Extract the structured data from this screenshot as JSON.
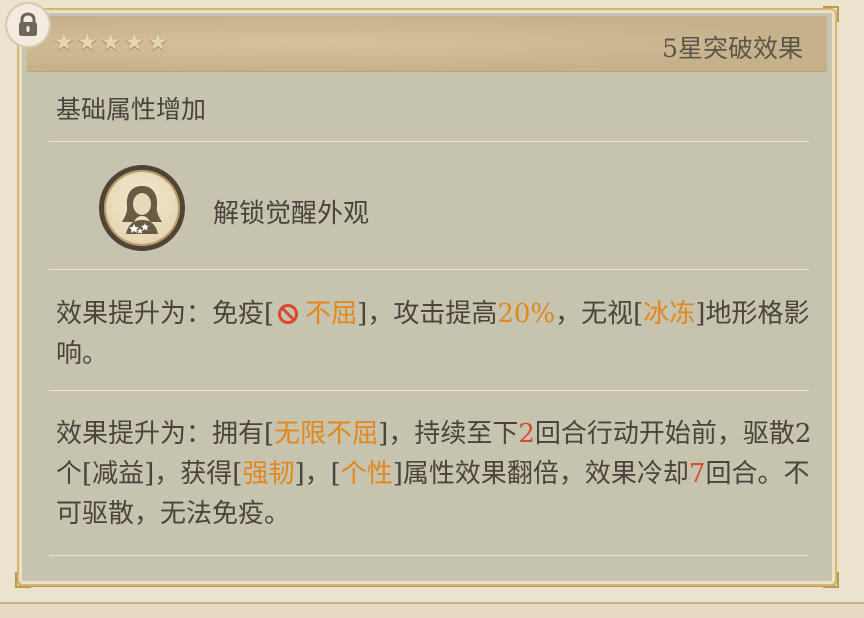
{
  "header": {
    "title": "5星突破效果",
    "stars": 5
  },
  "sections": {
    "base_attr": "基础属性增加",
    "awaken": {
      "label": "解锁觉醒外观",
      "icon": "character-portrait-icon"
    }
  },
  "effect1": {
    "p1": "效果提升为：免疫[",
    "status_icon": "prohibited-icon",
    "status": "不屈",
    "p2": "]，攻击提高",
    "attack": "20%",
    "p3": "，无视[",
    "terrain": "冰冻",
    "p4": "]地形格影响。"
  },
  "effect2": {
    "p1": "效果提升为：拥有[",
    "buff1": "无限不屈",
    "p2": "]，持续至下",
    "turns1": "2",
    "p3": "回合行动开始前，驱散2个[减益]，获得[",
    "buff2": "强韧",
    "p4": "]，[",
    "buff3": "个性",
    "p5": "]属性效果翻倍，效果冷却",
    "cooldown": "7",
    "p6": "回合。不可驱散，无法免疫。"
  },
  "colors": {
    "highlight": "#e3871b",
    "number": "#d9482f",
    "panel": "#c6c3ae",
    "frame": "#d6b56e"
  }
}
